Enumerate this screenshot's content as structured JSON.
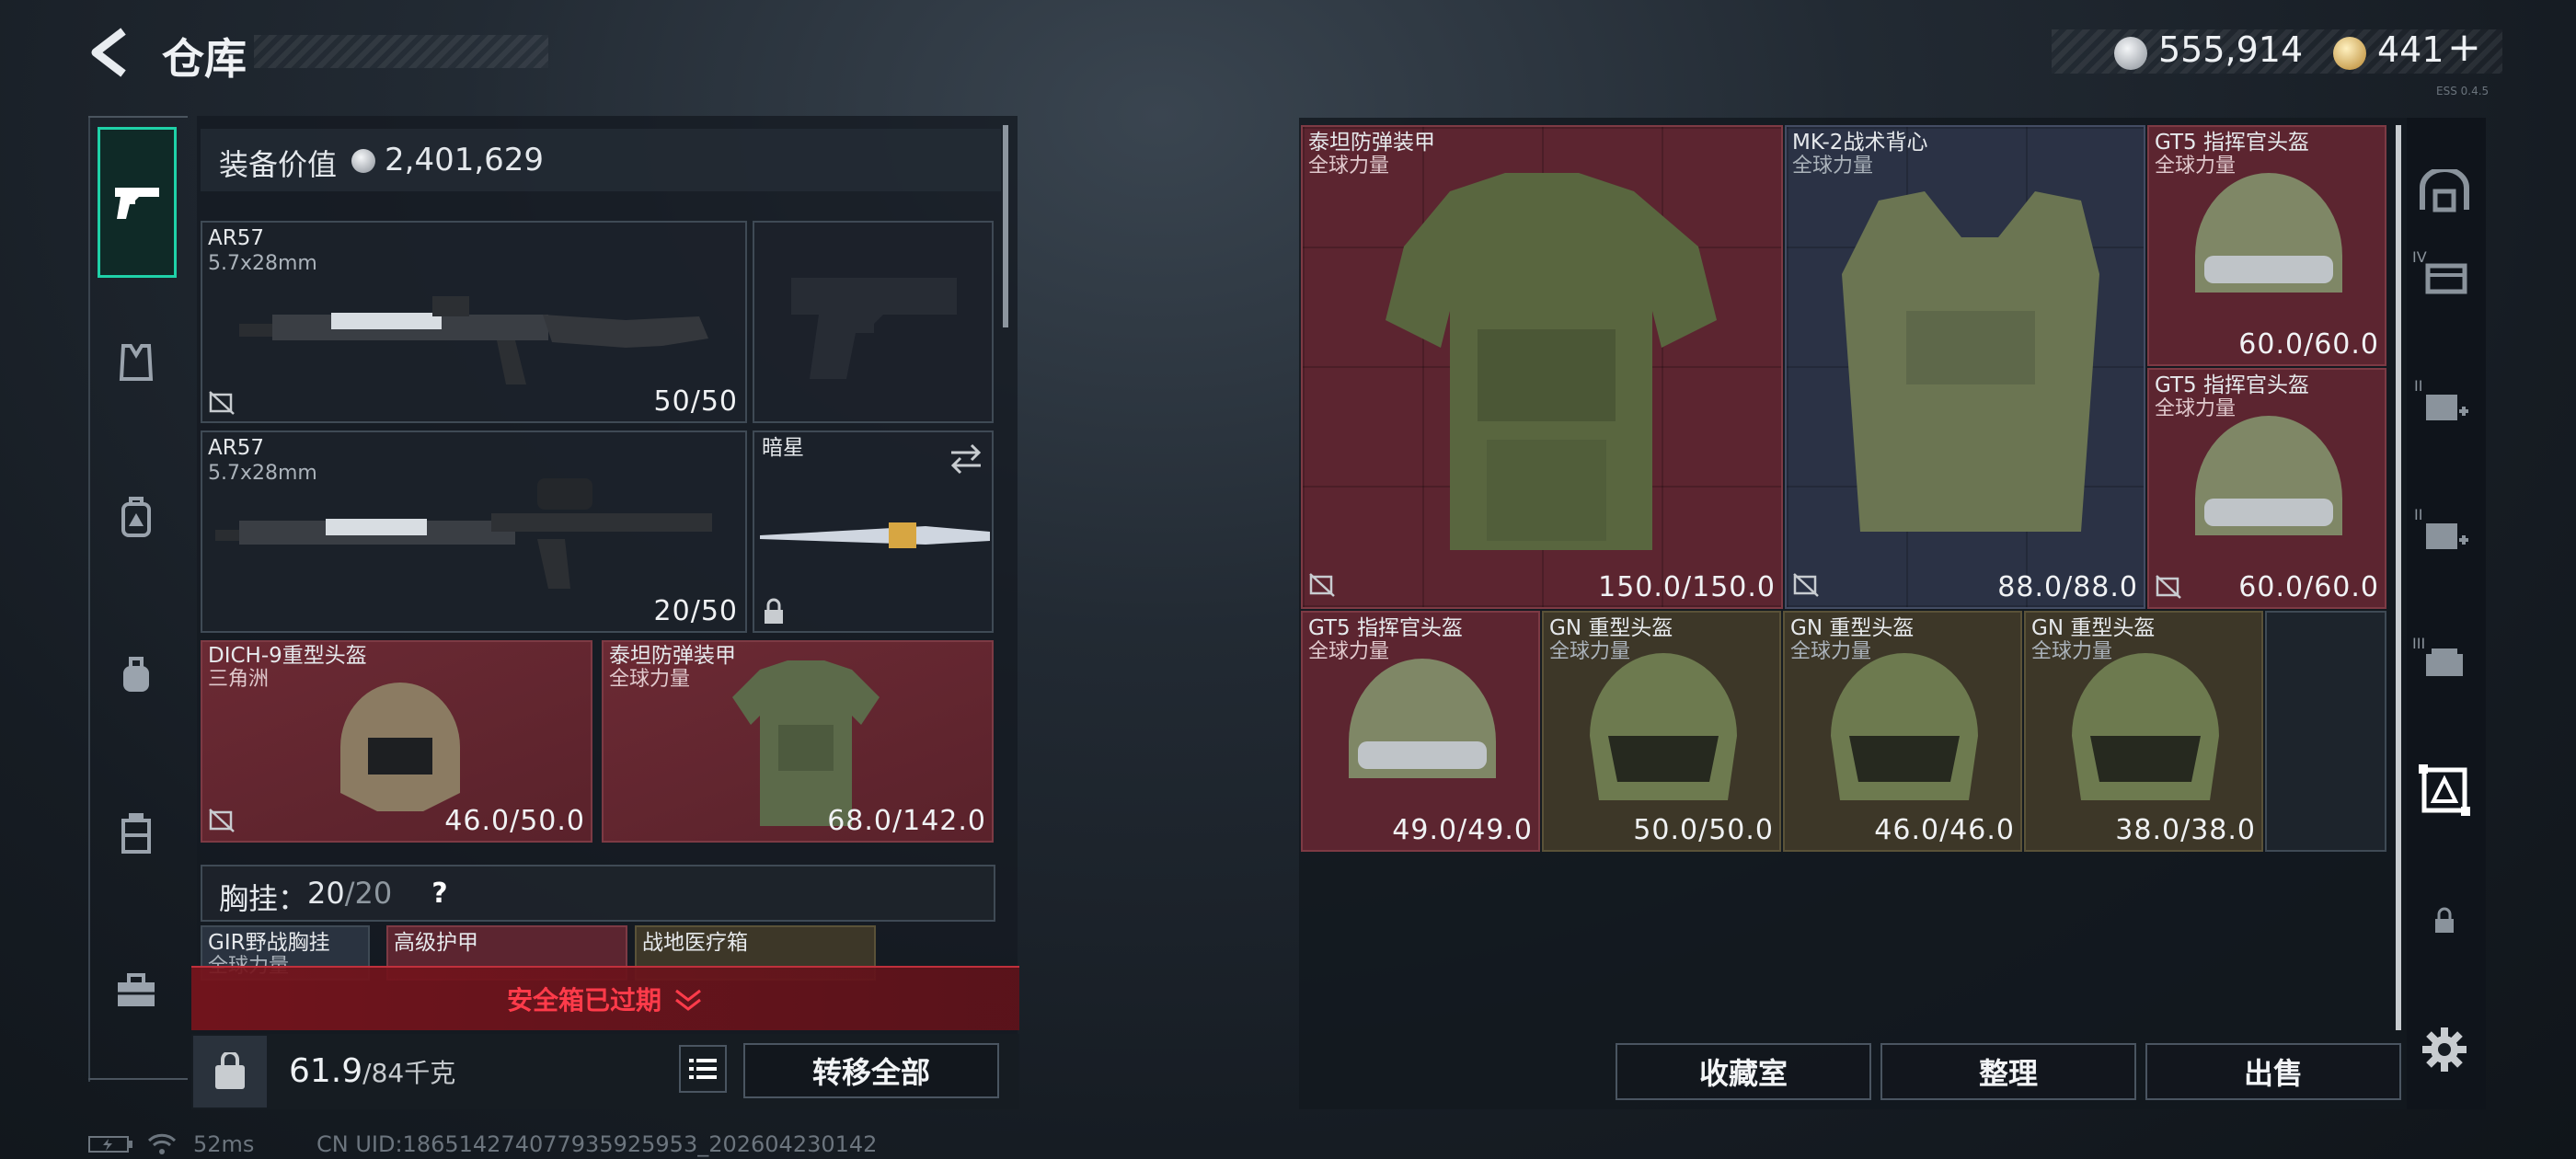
{
  "header": {
    "title": "仓库",
    "currency1": "555,914",
    "currency2": "441",
    "plus": "+",
    "version_tag": "ESS 0.4.5"
  },
  "equip_value": {
    "label": "装备价值",
    "value": "2,401,629"
  },
  "weapons": [
    {
      "name": "AR57",
      "caliber": "5.7x28mm",
      "durability": "50/50"
    },
    {
      "name": "AR57",
      "caliber": "5.7x28mm",
      "durability": "20/50"
    }
  ],
  "melee": {
    "name": "暗星"
  },
  "left_helmet": {
    "name": "DICH-9重型头盔",
    "sub": "三角洲",
    "durability": "46.0/50.0"
  },
  "left_armor": {
    "name": "泰坦防弹装甲",
    "sub": "全球力量",
    "durability": "68.0/142.0"
  },
  "chest_rig": {
    "label": "胸挂：",
    "count": "20",
    "max": "/20",
    "help": "?"
  },
  "rig_items": [
    {
      "name": "GIR野战胸挂",
      "sub": "全球力量"
    },
    {
      "name": "高级护甲"
    },
    {
      "name": "战地医疗箱"
    }
  ],
  "safebox": {
    "text": "安全箱已过期"
  },
  "weight": {
    "value": "61.9",
    "max": "/84千克"
  },
  "transfer_all": "转移全部",
  "status": {
    "ping": "52ms",
    "uid": "CN UID:186514274077935925953_202604230142"
  },
  "storage": [
    {
      "name": "泰坦防弹装甲",
      "sub": "全球力量",
      "durability": "150.0/150.0"
    },
    {
      "name": "MK-2战术背心",
      "sub": "全球力量",
      "durability": "88.0/88.0"
    },
    {
      "name": "GT5 指挥官头盔",
      "sub": "全球力量",
      "durability": "60.0/60.0"
    },
    {
      "name": "GT5 指挥官头盔",
      "sub": "全球力量",
      "durability": "60.0/60.0"
    },
    {
      "name": "GT5 指挥官头盔",
      "sub": "全球力量",
      "durability": "49.0/49.0"
    },
    {
      "name": "GN 重型头盔",
      "sub": "全球力量",
      "durability": "50.0/50.0"
    },
    {
      "name": "GN 重型头盔",
      "sub": "全球力量",
      "durability": "46.0/46.0"
    },
    {
      "name": "GN 重型头盔",
      "sub": "全球力量",
      "durability": "38.0/38.0"
    }
  ],
  "actions": {
    "collection": "收藏室",
    "sort": "整理",
    "sell": "出售"
  },
  "right_tabs": {
    "t1": "IV",
    "t2": "II",
    "t3": "II",
    "t4": "III"
  },
  "colors": {
    "accent": "#1fd1a8",
    "expired_red": "#ff3b4a",
    "rare_red": "#6b2a34",
    "blue_tier": "#2b3245",
    "olive_tier": "#3d3728"
  }
}
